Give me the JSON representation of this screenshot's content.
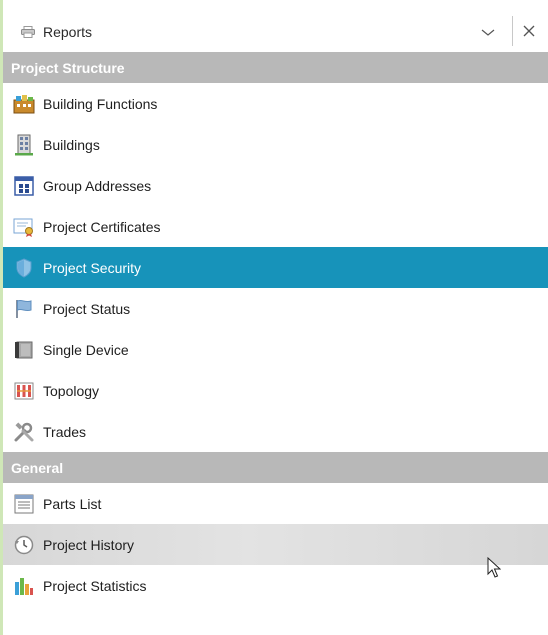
{
  "header": {
    "title": "Reports",
    "title_icon": "printer-icon",
    "dropdown_icon": "chevron-down-icon",
    "close_icon": "close-icon"
  },
  "sections": [
    {
      "label": "Project Structure",
      "items": [
        {
          "label": "Building Functions",
          "icon": "building-functions-icon"
        },
        {
          "label": "Buildings",
          "icon": "building-icon"
        },
        {
          "label": "Group Addresses",
          "icon": "group-addresses-icon"
        },
        {
          "label": "Project Certificates",
          "icon": "certificate-icon"
        },
        {
          "label": "Project Security",
          "icon": "shield-icon",
          "selected": true
        },
        {
          "label": "Project Status",
          "icon": "flag-icon"
        },
        {
          "label": "Single Device",
          "icon": "device-icon"
        },
        {
          "label": "Topology",
          "icon": "topology-icon"
        },
        {
          "label": "Trades",
          "icon": "tools-icon"
        }
      ]
    },
    {
      "label": "General",
      "items": [
        {
          "label": "Parts List",
          "icon": "parts-list-icon"
        },
        {
          "label": "Project History",
          "icon": "history-icon",
          "hover": true
        },
        {
          "label": "Project Statistics",
          "icon": "statistics-icon"
        }
      ]
    }
  ],
  "colors": {
    "selected_bg": "#1793ba",
    "section_bg": "#b8b8b8",
    "hover_bg": "#d9d9d9",
    "accent": "#cfe7b7"
  }
}
